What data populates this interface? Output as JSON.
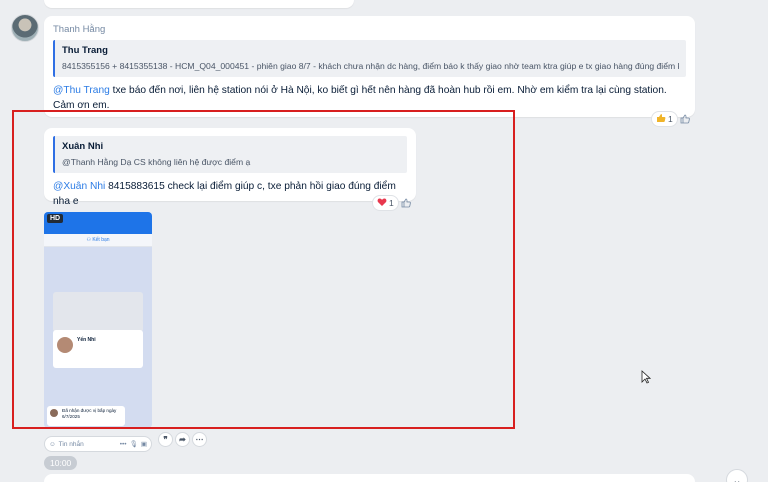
{
  "message1": {
    "sender": "Thanh Hằng",
    "quote_name": "Thu Trang",
    "quote_text": "8415355156 + 8415355138 - HCM_Q04_000451 - phiên giao 8/7 - khách chưa nhận dc hàng, điểm báo k thấy giao nhờ team ktra giúp e tx giao hàng đúng điểm k ạ...",
    "mention": "@Thu Trang",
    "text": " txe báo đến nơi, liên hệ station nói ở Hà Nội, ko biết gì hết nên hàng đã hoàn hub rồi em. Nhờ em kiểm tra lại cùng station. Cảm ơn em.",
    "reaction_count": "1"
  },
  "message2": {
    "quote_name": "Xuân Nhi",
    "quote_text": "@Thanh Hằng Dạ CS không liên hệ được điểm ạ",
    "mention": "@Xuân Nhi",
    "text": " 8415883615  check lại điểm giúp c, txe phản hồi giao đúng điểm nha e",
    "reaction_count": "1"
  },
  "image_message": {
    "badge": "HD",
    "phone_header_link": "Kết bạn",
    "card_name": "Yến Nhi",
    "note_text": "Đã nhận được vị bấp ngày 6/7/2025"
  },
  "composer": {
    "placeholder": "Tin nhắn"
  },
  "timestamp": "10:00",
  "colors": {
    "accent": "#2c7ce5",
    "highlight": "#d81f1f",
    "background": "#eceef1"
  }
}
